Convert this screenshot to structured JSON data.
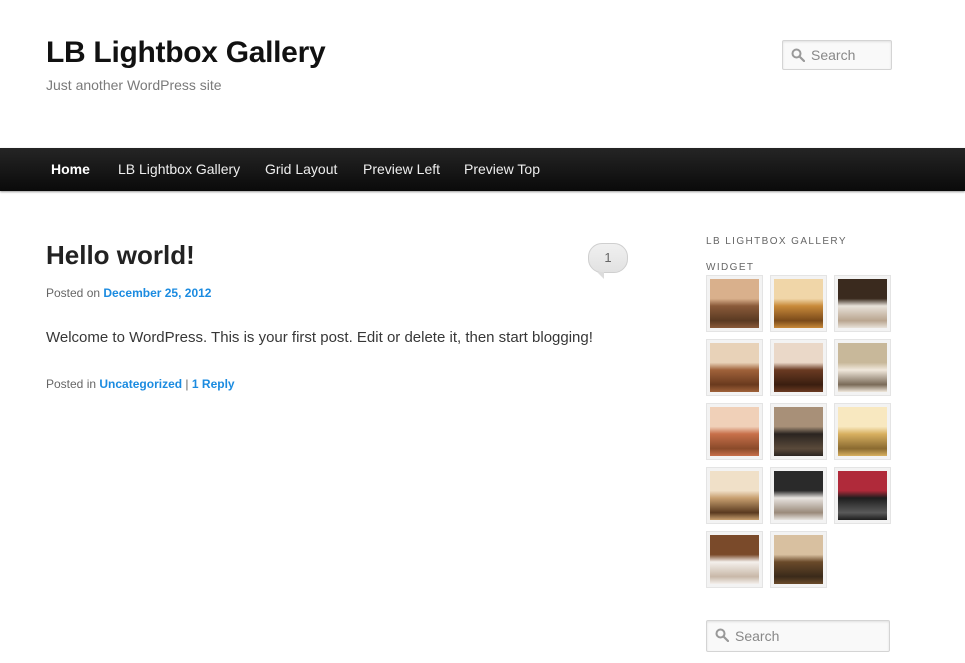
{
  "site": {
    "title": "LB Lightbox Gallery",
    "description": "Just another WordPress site"
  },
  "header_search": {
    "placeholder": "Search",
    "icon": "search-icon"
  },
  "nav": {
    "items": [
      {
        "label": "Home",
        "current": true
      },
      {
        "label": "LB Lightbox Gallery",
        "current": false
      },
      {
        "label": "Grid Layout",
        "current": false
      },
      {
        "label": "Preview Left",
        "current": false
      },
      {
        "label": "Preview Top",
        "current": false
      }
    ]
  },
  "post": {
    "title": "Hello world!",
    "comment_count": "1",
    "posted_on_label": "Posted on",
    "date": "December 25, 2012",
    "body": "Welcome to WordPress. This is your first post. Edit or delete it, then start blogging!",
    "posted_in_label": "Posted in",
    "category": "Uncategorized",
    "separator": "|",
    "reply_link": "1 Reply"
  },
  "sidebar": {
    "widget_title": "LB LIGHTBOX GALLERY WIDGET",
    "gallery": [
      {
        "name": "living-room-sofa",
        "colors": [
          "#8a5a3a",
          "#d9b08c",
          "#5a3a22"
        ]
      },
      {
        "name": "bedroom-orange",
        "colors": [
          "#c98a3a",
          "#f0d6a8",
          "#7a4a1a"
        ]
      },
      {
        "name": "bedroom-dark-bed",
        "colors": [
          "#e8e2da",
          "#3a2a1e",
          "#b9a58f"
        ]
      },
      {
        "name": "bedroom-wood",
        "colors": [
          "#a0623a",
          "#e8d2b8",
          "#6a3a1e"
        ]
      },
      {
        "name": "wall-unit-cabinet",
        "colors": [
          "#6a3a22",
          "#ead8c8",
          "#3a1e10"
        ]
      },
      {
        "name": "sectional-sofa",
        "colors": [
          "#f0e8dc",
          "#c8b89a",
          "#7a6a58"
        ]
      },
      {
        "name": "bedroom-terracotta",
        "colors": [
          "#c8704a",
          "#f0d0b8",
          "#8a4a2a"
        ]
      },
      {
        "name": "bedroom-night",
        "colors": [
          "#2a2420",
          "#a89078",
          "#5a4a3a"
        ]
      },
      {
        "name": "bedroom-gold",
        "colors": [
          "#d8b060",
          "#f8e8c0",
          "#8a6a30"
        ]
      },
      {
        "name": "bedroom-cream",
        "colors": [
          "#c8a070",
          "#f0e0c8",
          "#5a3a20"
        ]
      },
      {
        "name": "bedroom-modern-black",
        "colors": [
          "#e8e4e0",
          "#2a2a2a",
          "#9a8a7a"
        ]
      },
      {
        "name": "lounge-red-sofa",
        "colors": [
          "#1e1e1e",
          "#b02a3a",
          "#5a5a5a"
        ]
      },
      {
        "name": "bed-white-frame",
        "colors": [
          "#f4f0ec",
          "#7a4a2a",
          "#c8b8a8"
        ]
      },
      {
        "name": "living-room-armchairs",
        "colors": [
          "#6a4a2a",
          "#d8c0a0",
          "#3a2a1a"
        ]
      }
    ]
  },
  "widget_search": {
    "placeholder": "Search",
    "icon": "search-icon"
  }
}
